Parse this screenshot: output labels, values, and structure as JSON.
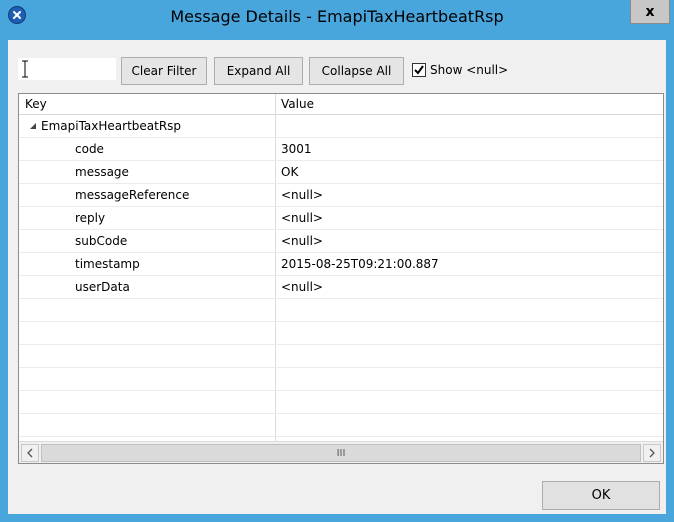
{
  "window": {
    "title": "Message Details - EmapiTaxHeartbeatRsp",
    "close_label": "x"
  },
  "toolbar": {
    "filter_value": "",
    "clear_filter_label": "Clear Filter",
    "expand_all_label": "Expand All",
    "collapse_all_label": "Collapse All",
    "show_null_label": "Show <null>",
    "show_null_checked": true
  },
  "table": {
    "columns": [
      "Key",
      "Value"
    ],
    "root": {
      "key": "EmapiTaxHeartbeatRsp",
      "value": "",
      "expanded": true
    },
    "rows": [
      {
        "key": "code",
        "value": "3001"
      },
      {
        "key": "message",
        "value": "OK"
      },
      {
        "key": "messageReference",
        "value": "<null>"
      },
      {
        "key": "reply",
        "value": "<null>"
      },
      {
        "key": "subCode",
        "value": "<null>"
      },
      {
        "key": "timestamp",
        "value": "2015-08-25T09:21:00.887"
      },
      {
        "key": "userData",
        "value": "<null>"
      }
    ]
  },
  "scrollbar": {
    "thumb_label": "III"
  },
  "footer": {
    "ok_label": "OK"
  },
  "colors": {
    "titlebar": "#48a6dd",
    "client": "#f0f0f0"
  }
}
